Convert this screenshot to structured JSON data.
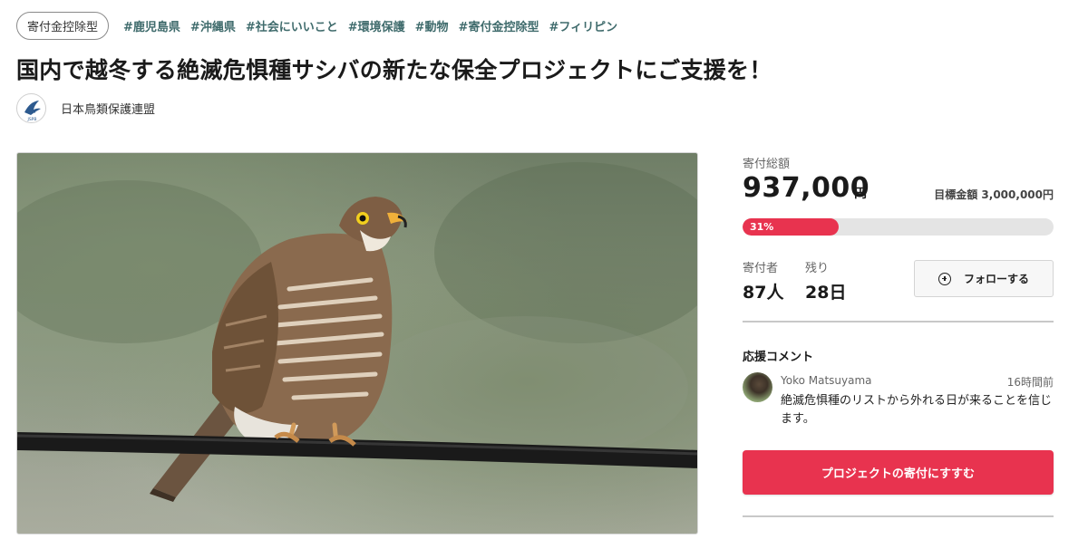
{
  "tags": {
    "type_pill": "寄付金控除型",
    "hashtags": [
      "#鹿児島県",
      "#沖縄県",
      "#社会にいいこと",
      "#環境保護",
      "#動物",
      "#寄付金控除型",
      "#フィリピン"
    ]
  },
  "project": {
    "title": "国内で越冬する絶滅危惧種サシバの新たな保全プロジェクトにご支援を！",
    "organization": "日本鳥類保護連盟",
    "org_logo_text": "JSPB",
    "image_icon": "hawk-photo"
  },
  "funding": {
    "raised_label": "寄付総額",
    "raised_amount": "937,000",
    "raised_unit": "円",
    "goal_text": "目標金額 3,000,000円",
    "progress_label": "31%",
    "progress_fraction": 0.31,
    "accent_color": "#e8334f"
  },
  "stats": {
    "donors_label": "寄付者",
    "donors_value": "87人",
    "remaining_label": "残り",
    "remaining_value": "28日",
    "follow_label": "フォローする",
    "follow_icon": "plus-circle-icon"
  },
  "comments": {
    "heading": "応援コメント",
    "items": [
      {
        "name": "Yoko Matsuyama",
        "time": "16時間前",
        "text": "絶滅危惧種のリストから外れる日が来ることを信じます。"
      }
    ]
  },
  "cta": {
    "donate_label": "プロジェクトの寄付にすすむ"
  }
}
